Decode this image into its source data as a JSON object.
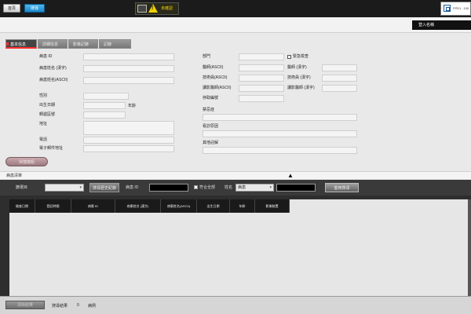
{
  "topbar": {
    "home_label": "首頁",
    "search_label": "搜尋",
    "unconfirmed_label": "未確認",
    "fpd_label": "FPD1 : 100"
  },
  "header": {
    "login_name": "登入名稱"
  },
  "tabs": [
    "基本信息",
    "詳細信息",
    "影像記錄",
    "記錄"
  ],
  "form": {
    "patient_id": "病患 ID",
    "name_kanji": "病患姓名 (漢字)",
    "name_ascii": "病患姓名(ASCII)",
    "sex": "性別",
    "birthdate": "出生日期",
    "age_unit": "年齡",
    "postal_code": "郵遞區號",
    "address": "地址",
    "phone": "電話",
    "email": "電子郵件地址",
    "department": "部門",
    "emergency": "緊急檢查",
    "physician_ascii": "醫師(ASCII)",
    "physician_kanji": "醫師 (漢字)",
    "technician_ascii": "技術員(ASCII)",
    "technician_kanji": "技術員 (漢字)",
    "reading_ascii": "讀影醫師(ASCII)",
    "reading_kanji": "讀影醫師 (漢字)",
    "storage_no": "存取編號",
    "complaint": "禁忌症",
    "reason": "看診原因",
    "notes": "其他註解",
    "register_button": "掃描模組"
  },
  "patient_list": {
    "title": "病患清單",
    "collapse_glyph": "▲"
  },
  "search_bar": {
    "target_label": "篩選目",
    "history_button": "搜尋歷史紀錄",
    "id_label": "病患 ID",
    "all_label": "符合全部",
    "type_label": "姓名",
    "type_value": "病患",
    "search_button": "套用搜尋"
  },
  "results": {
    "columns": [
      "檢查日期",
      "登記時間",
      "病患 ID",
      "病患姓名 (漢字)",
      "病患姓名(ASCII)",
      "出生日期",
      "年齡",
      "影像裝置"
    ]
  },
  "status_bar": {
    "clear_button": "清除結果",
    "label": "搜尋結果",
    "count": "0",
    "unit": "病例"
  },
  "colors": {
    "accent_blue": "#1a86c8",
    "warning_yellow": "#f0d000",
    "active_tab_red": "#ff2d2d"
  }
}
